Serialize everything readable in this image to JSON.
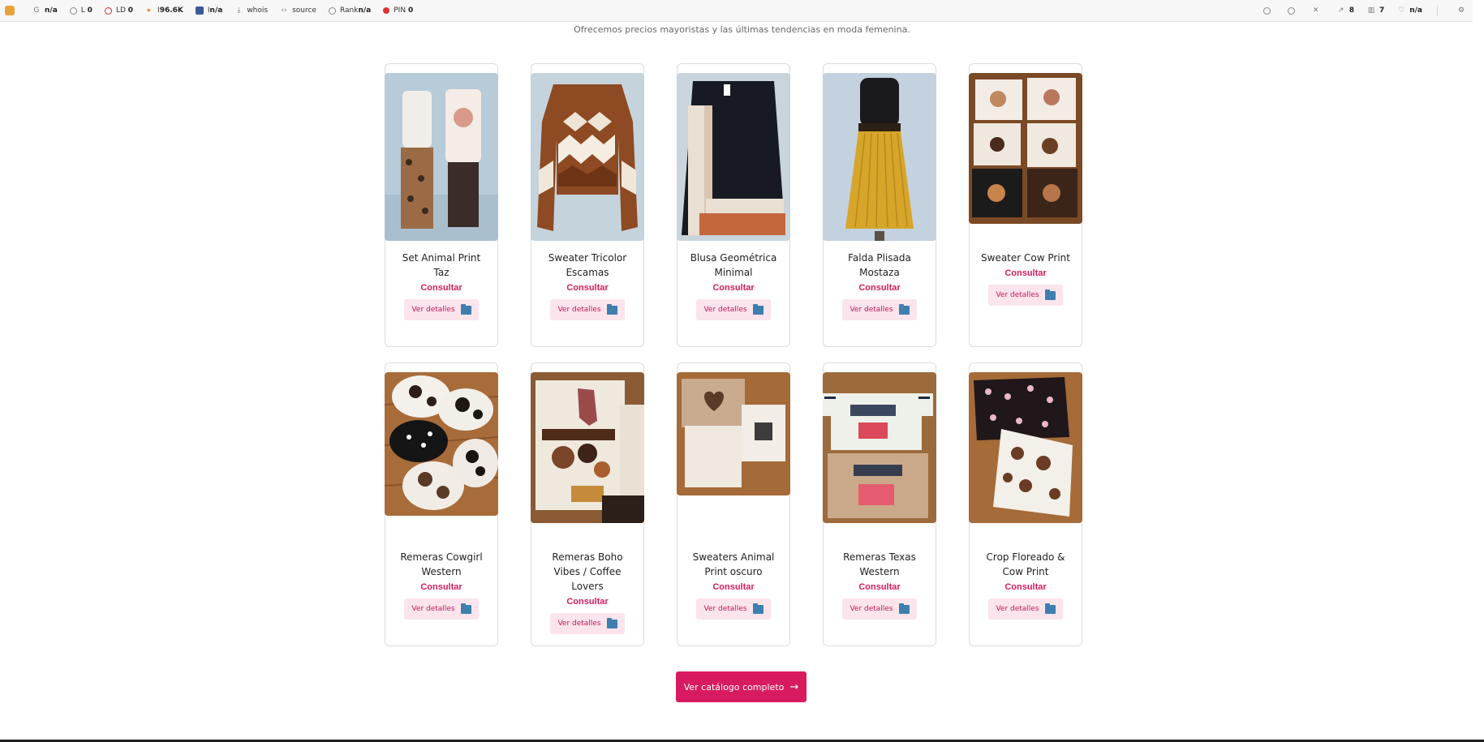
{
  "toolbar": {
    "items": [
      {
        "icon": "google-g-icon",
        "label": "G",
        "value": "n/a"
      },
      {
        "icon": "circle-icon",
        "label": "L",
        "value": "0"
      },
      {
        "icon": "circle-red-icon",
        "label": "LD",
        "value": "0"
      },
      {
        "icon": "play-icon",
        "label": "I",
        "value": "96.6K"
      },
      {
        "icon": "facebook-icon",
        "label": "I",
        "value": "n/a"
      },
      {
        "icon": "download-icon",
        "label": "whois",
        "value": ""
      },
      {
        "icon": "code-icon",
        "label": "source",
        "value": ""
      },
      {
        "icon": "circle-icon",
        "label": "Rank",
        "value": "n/a"
      },
      {
        "icon": "pinterest-icon",
        "label": "PIN",
        "value": "0"
      }
    ],
    "right_items": [
      {
        "icon": "info-icon",
        "value": ""
      },
      {
        "icon": "eye-icon",
        "value": ""
      },
      {
        "icon": "cross-icon",
        "value": ""
      },
      {
        "icon": "external-link-icon",
        "value": "8"
      },
      {
        "icon": "chart-icon",
        "value": "7"
      },
      {
        "icon": "heart-icon",
        "value": "n/a"
      },
      {
        "icon": "gear-icon",
        "value": ""
      }
    ]
  },
  "tagline": "Ofrecemos precios mayoristas y las últimas tendencias en moda femenina.",
  "products": [
    {
      "name": "Set Animal Print Taz",
      "price": "Consultar",
      "button": "Ver detalles"
    },
    {
      "name": "Sweater Tricolor Escamas",
      "price": "Consultar",
      "button": "Ver detalles"
    },
    {
      "name": "Blusa Geométrica Minimal",
      "price": "Consultar",
      "button": "Ver detalles"
    },
    {
      "name": "Falda Plisada Mostaza",
      "price": "Consultar",
      "button": "Ver detalles"
    },
    {
      "name": "Sweater Cow Print",
      "price": "Consultar",
      "button": "Ver detalles"
    },
    {
      "name": "Remeras Cowgirl Western",
      "price": "Consultar",
      "button": "Ver detalles"
    },
    {
      "name": "Remeras Boho Vibes / Coffee Lovers",
      "price": "Consultar",
      "button": "Ver detalles"
    },
    {
      "name": "Sweaters Animal Print oscuro",
      "price": "Consultar",
      "button": "Ver detalles"
    },
    {
      "name": "Remeras Texas Western",
      "price": "Consultar",
      "button": "Ver detalles"
    },
    {
      "name": "Crop Floreado & Cow Print",
      "price": "Consultar",
      "button": "Ver detalles"
    }
  ],
  "cta": {
    "label": "Ver catálogo completo",
    "arrow": "→"
  },
  "colors": {
    "accent": "#d81b60",
    "button_bg": "#fbe4ec"
  }
}
